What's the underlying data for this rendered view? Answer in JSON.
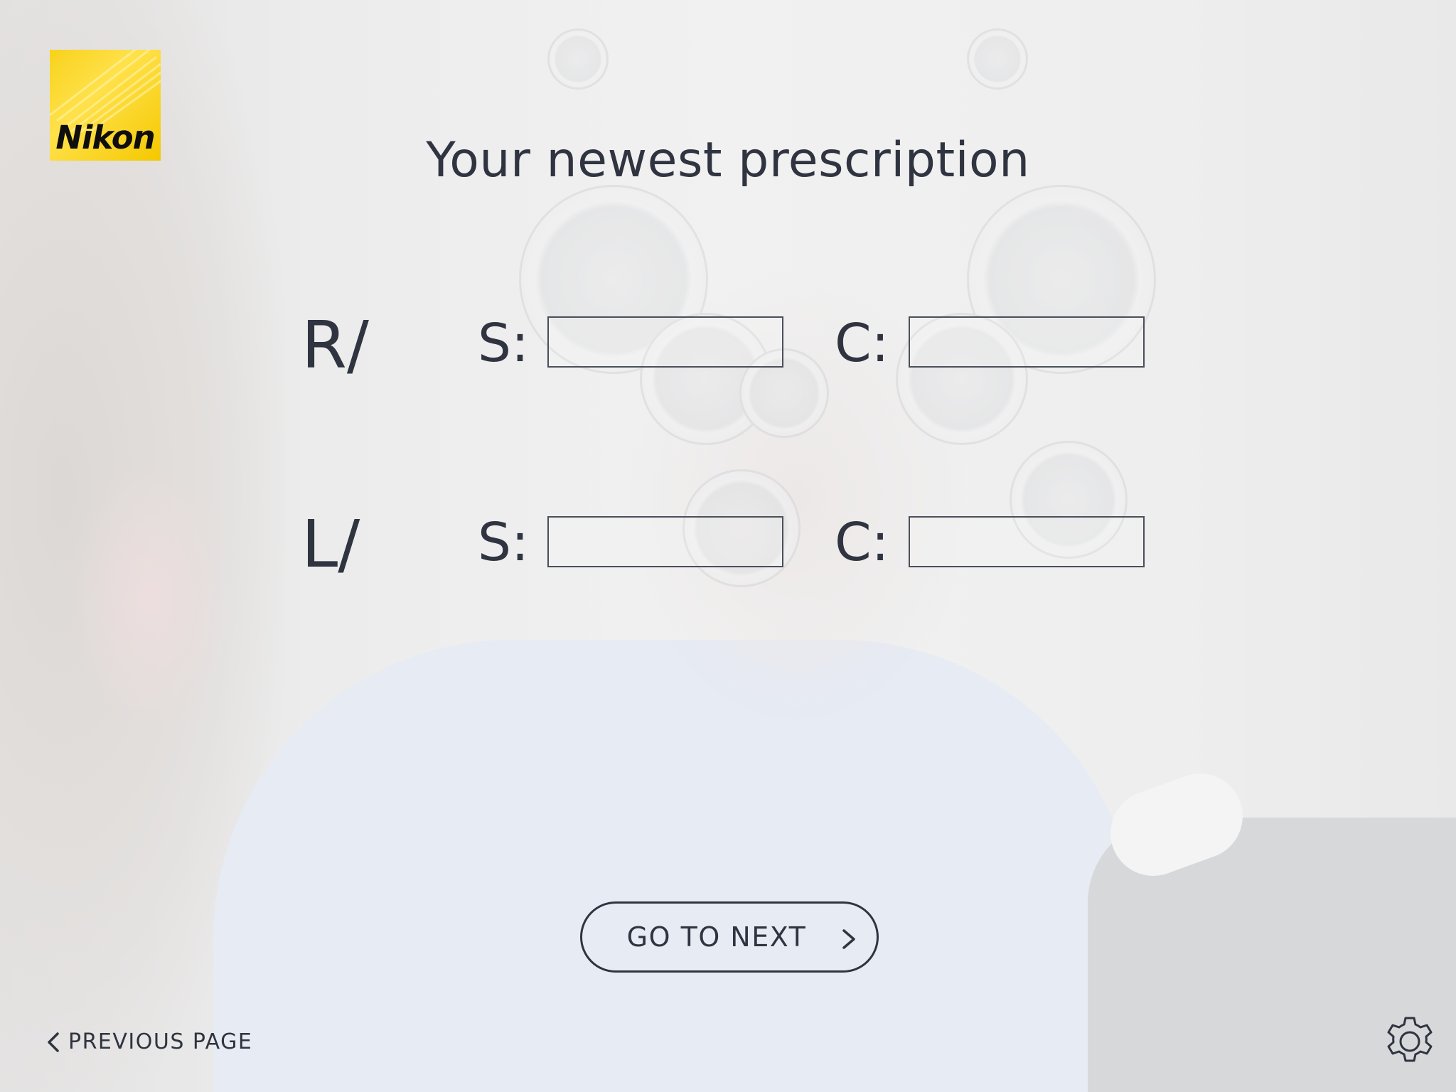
{
  "brand": {
    "logo_text": "Nikon",
    "logo_color": "#f7d21c"
  },
  "page": {
    "title": "Your newest prescription"
  },
  "prescription": {
    "right": {
      "eye_label": "R/",
      "sphere_label": "S:",
      "cylinder_label": "C:",
      "sphere_value": "",
      "cylinder_value": ""
    },
    "left": {
      "eye_label": "L/",
      "sphere_label": "S:",
      "cylinder_label": "C:",
      "sphere_value": "",
      "cylinder_value": ""
    }
  },
  "actions": {
    "next_label": "GO TO NEXT",
    "previous_label": "PREVIOUS PAGE"
  },
  "icons": {
    "next": "chevron-right-icon",
    "previous": "chevron-left-icon",
    "settings": "gear-icon"
  },
  "colors": {
    "text": "#2f3440",
    "background": "#eef0f2"
  }
}
